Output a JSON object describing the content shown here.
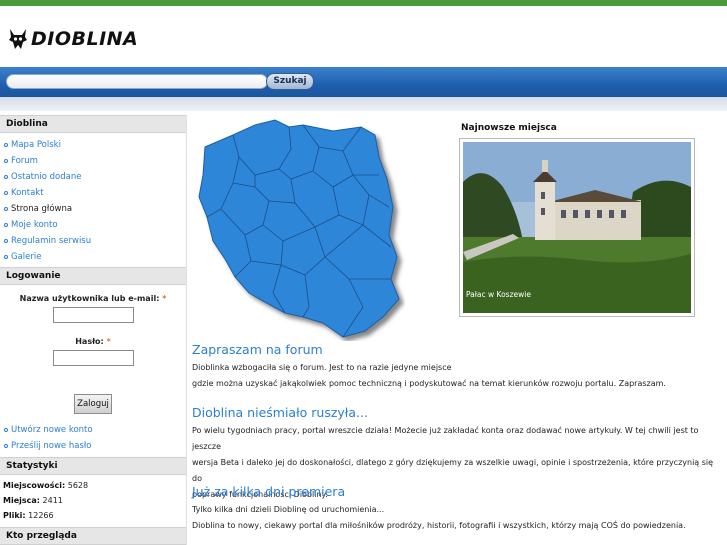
{
  "colors": {
    "accent_link": "#2a7fd4",
    "header_bar": "#1f5fae",
    "top_strip": "#4a9a3a",
    "poland_fill": "#2e86d9"
  },
  "header": {
    "logo_text": "DIOBLINA"
  },
  "search": {
    "value": "",
    "button_label": "Szukaj"
  },
  "sidebar": {
    "nav_title": "Dioblina",
    "items": [
      {
        "label": "Mapa Polski",
        "link": true
      },
      {
        "label": "Forum",
        "link": true
      },
      {
        "label": "Ostatnio dodane",
        "link": true
      },
      {
        "label": "Kontakt",
        "link": true
      },
      {
        "label": "Strona główna",
        "link": false
      },
      {
        "label": "Moje konto",
        "link": true
      },
      {
        "label": "Regulamin serwisu",
        "link": true
      },
      {
        "label": "Galerie",
        "link": true
      }
    ],
    "login": {
      "title": "Logowanie",
      "username_label": "Nazwa użytkownika lub e-mail:",
      "password_label": "Hasło:",
      "required_mark": "*",
      "submit_label": "Zaloguj",
      "links": [
        "Utwórz nowe konto",
        "Prześlij nowe hasło"
      ]
    },
    "stats": {
      "title": "Statystyki",
      "rows": [
        {
          "label": "Miejscowości:",
          "value": "5628"
        },
        {
          "label": "Miejsca:",
          "value": "2411"
        },
        {
          "label": "Pliki:",
          "value": "12266"
        }
      ]
    },
    "who_title": "Kto przegląda"
  },
  "main": {
    "newest_title": "Najnowsze miejsca",
    "photo_caption": "Pałac w Koszewie",
    "articles": [
      {
        "title": "Zapraszam na forum",
        "lines": [
          "Dioblinka wzbogaciła się o forum. Jest to na razie jedyne miejsce",
          "gdzie można uzyskać jakąkolwiek pomoc techniczną i podyskutować na temat kierunków rozwoju portalu. Zapraszam."
        ]
      },
      {
        "title": "Dioblina nieśmiało ruszyła...",
        "lines": [
          "Po wielu tygodniach pracy, portal wreszcie działa! Możecie już zakładać konta oraz dodawać nowe artykuły. W tej chwili jest to jeszcze",
          "wersja Beta i daleko jej do doskonałości, dlatego z góry dziękujemy za wszelkie uwagi, opinie i spostrzeżenia, które przyczynią się do",
          "poprawy funkcjonalności Diobliny."
        ]
      },
      {
        "title": "Już za kilka dni premiera",
        "lines": [
          "Tylko kilka dni dzieli Dioblinę od uruchomienia...",
          "Dioblina to nowy, ciekawy portal dla miłośników prodróży, historii, fotografii i wszystkich, którzy mają COŚ do powiedzenia."
        ]
      }
    ]
  }
}
